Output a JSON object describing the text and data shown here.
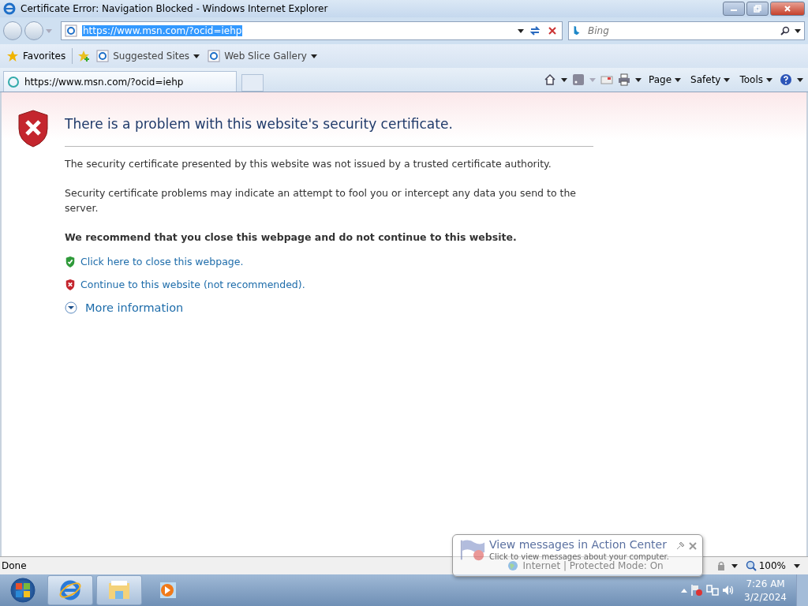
{
  "window": {
    "title": "Certificate Error: Navigation Blocked - Windows Internet Explorer"
  },
  "address_bar": {
    "value": "https://www.msn.com/?ocid=iehp"
  },
  "search": {
    "placeholder": "Bing"
  },
  "favorites_bar": {
    "favorites": "Favorites",
    "links": [
      "Suggested Sites",
      "Web Slice Gallery"
    ]
  },
  "tabs": [
    {
      "label": "https://www.msn.com/?ocid=iehp",
      "selected": true
    }
  ],
  "command_bar": [
    "Page",
    "Safety",
    "Tools"
  ],
  "page": {
    "heading": "There is a problem with this website's security certificate.",
    "paragraphs": [
      "The security certificate presented by this website was not issued by a trusted certificate authority.",
      "Security certificate problems may indicate an attempt to fool you or intercept any data you send to the server."
    ],
    "recommendation": "We recommend that you close this webpage and do not continue to this website.",
    "actions": [
      {
        "kind": "safe",
        "label": "Click here to close this webpage."
      },
      {
        "kind": "unsafe",
        "label": "Continue to this website (not recommended)."
      }
    ],
    "more": {
      "label": "More information",
      "expanded": false
    }
  },
  "status_bar": {
    "text": "Done",
    "zone": "Internet | Protected Mode: On",
    "zoom": "100%"
  },
  "notification": {
    "title": "View messages in Action Center",
    "text": "Click to view messages about your computer."
  },
  "clock": {
    "time": "7:26 AM",
    "date": "3/2/2024"
  }
}
